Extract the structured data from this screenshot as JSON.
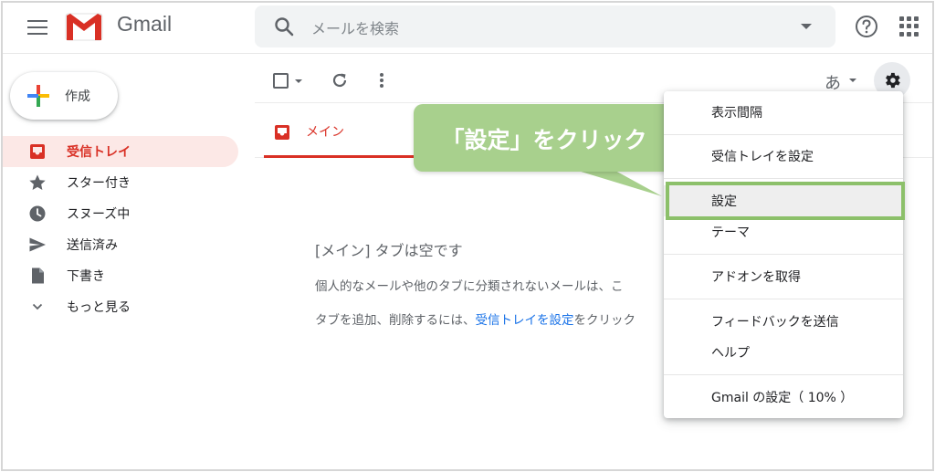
{
  "header": {
    "brand": "Gmail",
    "search_placeholder": "メールを検索"
  },
  "sidebar": {
    "compose_label": "作成",
    "items": [
      {
        "label": "受信トレイ",
        "icon": "inbox-icon",
        "active": true
      },
      {
        "label": "スター付き",
        "icon": "star-icon"
      },
      {
        "label": "スヌーズ中",
        "icon": "clock-icon"
      },
      {
        "label": "送信済み",
        "icon": "send-icon"
      },
      {
        "label": "下書き",
        "icon": "draft-icon"
      },
      {
        "label": "もっと見る",
        "icon": "chevron-down-icon"
      }
    ]
  },
  "toolbar": {
    "ime_label": "あ"
  },
  "tabs": {
    "main_label": "メイン"
  },
  "empty_state": {
    "title": "[メイン] タブは空です",
    "line1": "個人的なメールや他のタブに分類されないメールは、こ",
    "line2_prefix": "タブを追加、削除するには、",
    "line2_link": "受信トレイを設定",
    "line2_suffix": "をクリック"
  },
  "callout": {
    "text": "「設定」をクリック"
  },
  "menu": {
    "items": [
      "表示間隔",
      "受信トレイを設定",
      "設定",
      "テーマ",
      "アドオンを取得",
      "フィードバックを送信",
      "ヘルプ",
      "Gmail の設定（ 10% ）"
    ]
  },
  "colors": {
    "accent_red": "#d93025",
    "link_blue": "#1a73e8",
    "callout_green": "#a8d08d",
    "highlight_green": "#8cc06a"
  }
}
